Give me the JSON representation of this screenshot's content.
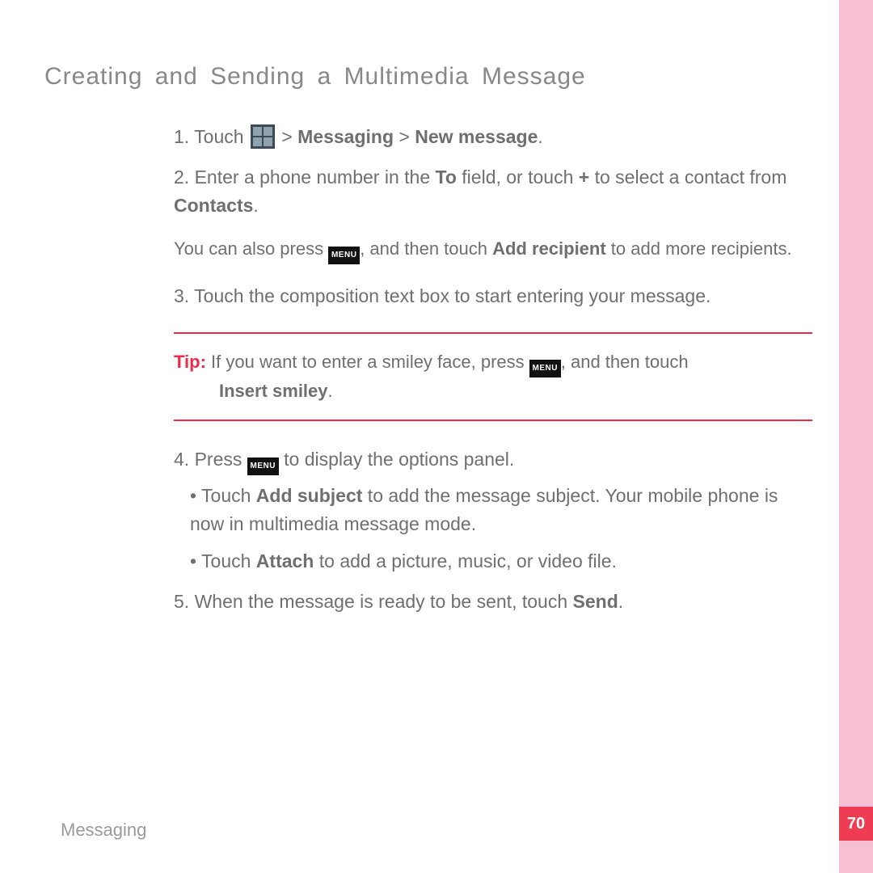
{
  "page": {
    "title": "Creating and Sending a Multimedia Message",
    "footer_section": "Messaging",
    "page_number": "70"
  },
  "icons": {
    "menu_label": "MENU"
  },
  "steps": {
    "s1": {
      "num": "1. ",
      "prefix": "Touch ",
      "gt1": " > ",
      "b1": "Messaging",
      "gt2": " > ",
      "b2": "New message",
      "period": "."
    },
    "s2": {
      "num": "2. ",
      "t1": "Enter a phone number in the ",
      "b1": "To",
      "t2": " field, or touch ",
      "b2": "+",
      "t3": " to select a contact from ",
      "b3": "Contacts",
      "period": "."
    },
    "note2": {
      "t1": "You can also press ",
      "t2": ", and then touch ",
      "b1": "Add recipient",
      "t3": " to add more recipients."
    },
    "s3": {
      "num": "3. ",
      "t1": "Touch the composition text box to start entering your message."
    },
    "tip": {
      "label": "Tip:  ",
      "t1": "If you want to enter a smiley face, press ",
      "t2": ", and then touch",
      "b1": "Insert smiley",
      "period": "."
    },
    "s4": {
      "num": "4. ",
      "t1": "Press ",
      "t2": " to display the options panel."
    },
    "b4a": {
      "dot": "• ",
      "t1": "Touch ",
      "b1": "Add subject",
      "t2": " to add the message subject. Your mobile phone is now in multimedia message mode."
    },
    "b4b": {
      "dot": "• ",
      "t1": "Touch ",
      "b1": "Attach",
      "t2": " to add a picture, music, or video file."
    },
    "s5": {
      "num": "5. ",
      "t1": "When the message is ready to be sent, touch ",
      "b1": "Send",
      "period": "."
    }
  }
}
